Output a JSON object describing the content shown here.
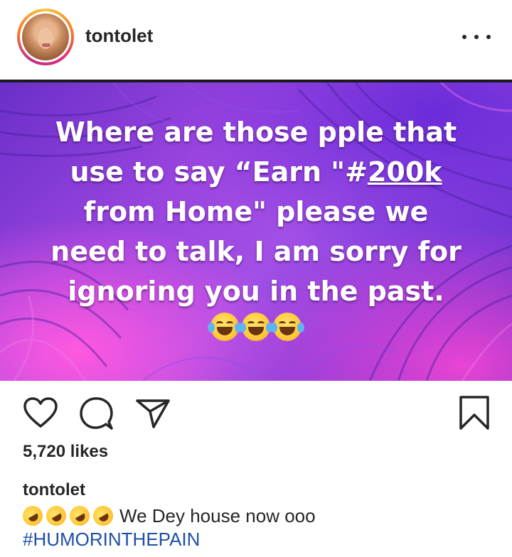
{
  "header": {
    "username": "tontolet",
    "more_icon": "more-horizontal-icon"
  },
  "post": {
    "lines": [
      "Where are those pple that",
      "use to say “Earn \"#",
      "200k",
      "from Home\" please we",
      "need to talk, I am sorry for",
      "ignoring you in the  past."
    ],
    "emoji": "face-with-tears-of-joy"
  },
  "actions": {
    "like_icon": "heart-icon",
    "comment_icon": "comment-icon",
    "share_icon": "paper-plane-icon",
    "save_icon": "bookmark-icon"
  },
  "likes": "5,720 likes",
  "caption": {
    "username": "tontolet",
    "emoji": "rolling-on-floor-laughing",
    "text": "We Dey house now ooo",
    "hashtag": "#HUMORINTHEPAIN"
  },
  "colors": {
    "text": "#262626",
    "hashtag": "#1f4fa5",
    "post_bg": "#9b45e0"
  }
}
